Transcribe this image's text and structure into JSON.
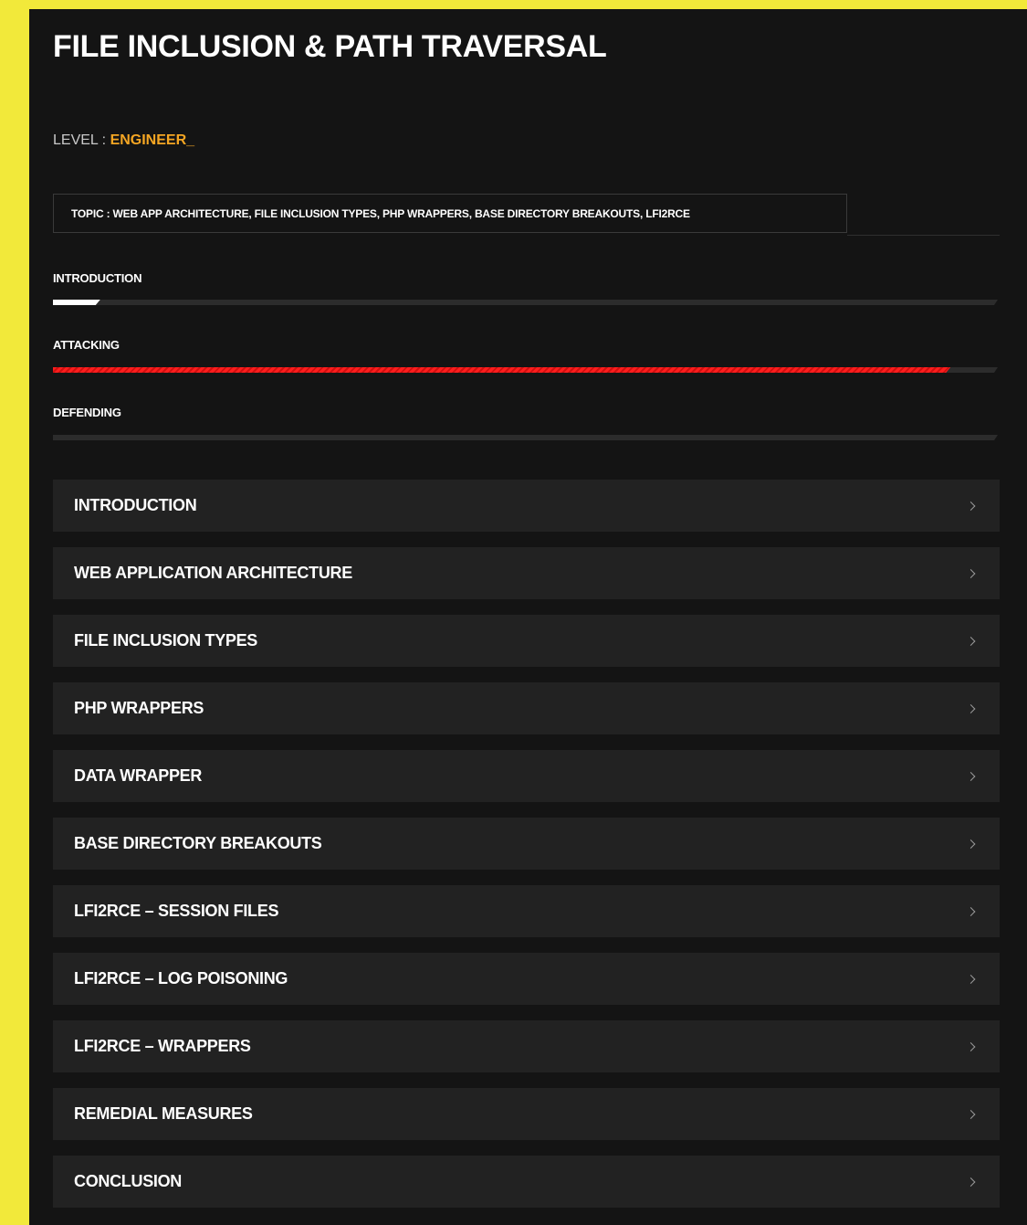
{
  "page": {
    "title": "FILE INCLUSION & PATH TRAVERSAL",
    "level_label": "LEVEL : ",
    "level_value": "ENGINEER_",
    "topic": "TOPIC : WEB APP ARCHITECTURE, FILE INCLUSION TYPES, PHP WRAPPERS, BASE DIRECTORY BREAKOUTS, LFI2RCE"
  },
  "colors": {
    "page_background": "#141414",
    "outer_background": "#f2e93a",
    "level_accent": "#f5a623",
    "attacking_bar": "#ff1e1e",
    "introduction_bar": "#ffffff",
    "card_background": "#222222"
  },
  "progress": [
    {
      "label": "INTRODUCTION",
      "fraction": 0.05,
      "color_role": "white"
    },
    {
      "label": "ATTACKING",
      "fraction": 0.95,
      "color_role": "red"
    },
    {
      "label": "DEFENDING",
      "fraction": 0.0,
      "color_role": "none"
    }
  ],
  "sections": [
    {
      "label": "INTRODUCTION",
      "icon": "chevron-right-icon"
    },
    {
      "label": "WEB APPLICATION ARCHITECTURE",
      "icon": "chevron-right-icon"
    },
    {
      "label": "FILE INCLUSION TYPES",
      "icon": "chevron-right-icon"
    },
    {
      "label": "PHP WRAPPERS",
      "icon": "chevron-right-icon"
    },
    {
      "label": "DATA WRAPPER",
      "icon": "chevron-right-icon"
    },
    {
      "label": "BASE DIRECTORY BREAKOUTS",
      "icon": "chevron-right-icon"
    },
    {
      "label": "LFI2RCE – SESSION FILES",
      "icon": "chevron-right-icon"
    },
    {
      "label": "LFI2RCE – LOG POISONING",
      "icon": "chevron-right-icon"
    },
    {
      "label": "LFI2RCE – WRAPPERS",
      "icon": "chevron-right-icon"
    },
    {
      "label": "REMEDIAL MEASURES",
      "icon": "chevron-right-icon"
    },
    {
      "label": "CONCLUSION",
      "icon": "chevron-right-icon"
    }
  ]
}
